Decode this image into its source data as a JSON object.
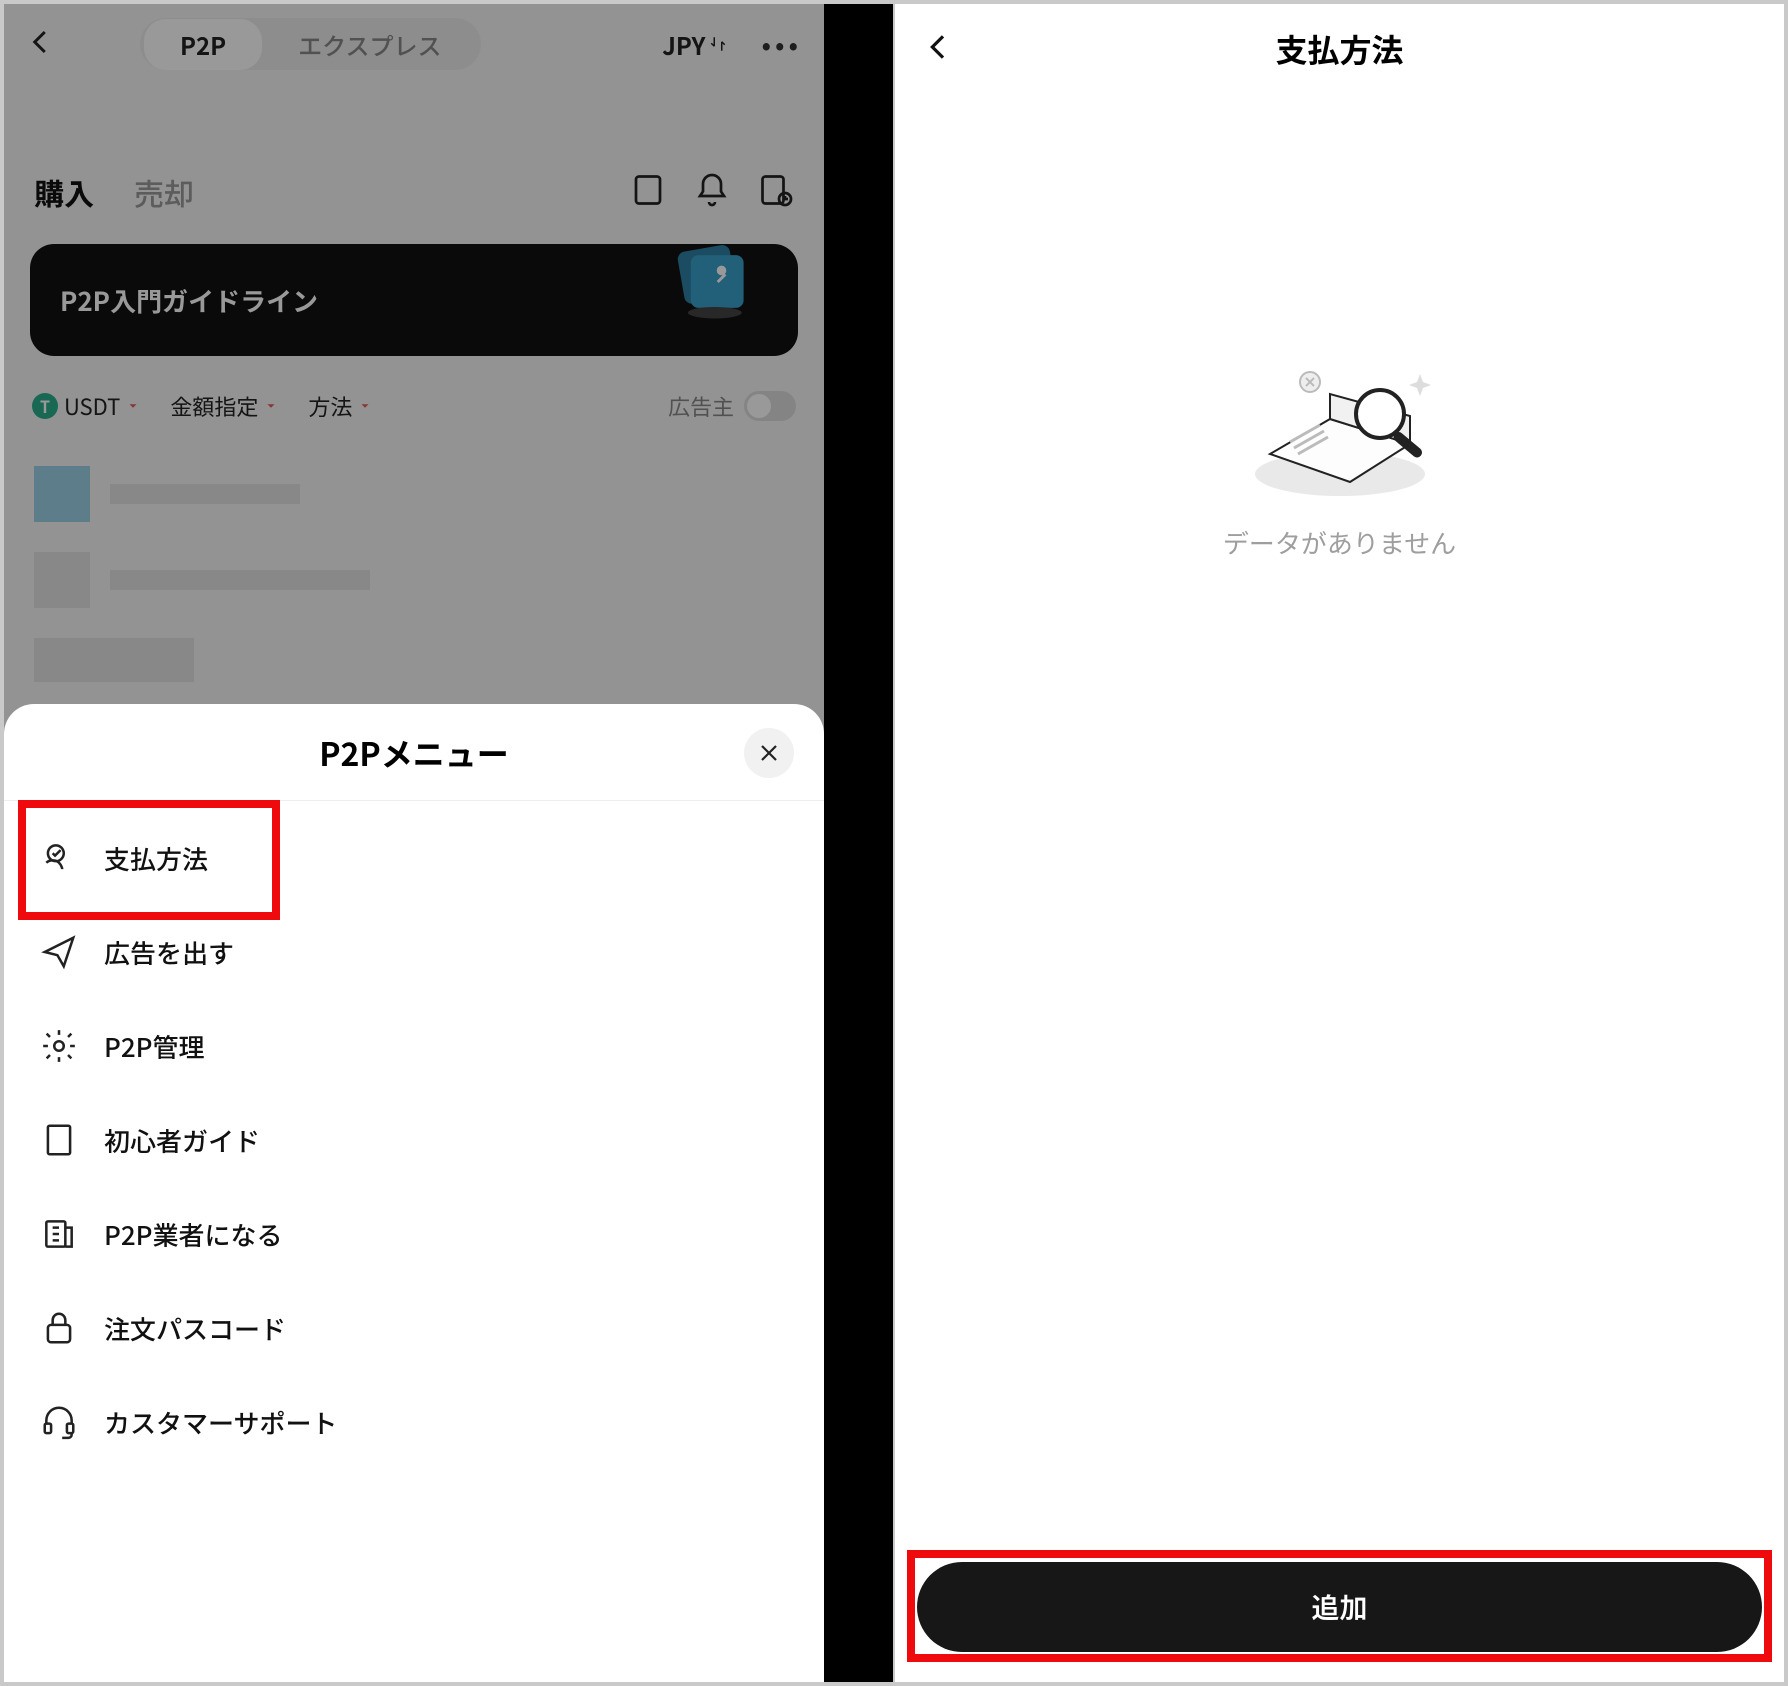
{
  "left": {
    "segmented": {
      "active": "P2P",
      "inactive": "エクスプレス"
    },
    "currency": "JPY",
    "tabs": {
      "buy": "購入",
      "sell": "売却"
    },
    "banner": "P2P入門ガイドライン",
    "filters": {
      "coin": "USDT",
      "amount": "金額指定",
      "method": "方法",
      "advertiser": "広告主"
    },
    "sheet": {
      "title": "P2Pメニュー",
      "items": [
        "支払方法",
        "広告を出す",
        "P2P管理",
        "初心者ガイド",
        "P2P業者になる",
        "注文パスコード",
        "カスタマーサポート"
      ]
    }
  },
  "right": {
    "title": "支払方法",
    "empty": "データがありません",
    "add": "追加"
  },
  "colors": {
    "highlight": "#ef0a0d",
    "primary_dark": "#171717",
    "teal": "#2aae8c"
  }
}
